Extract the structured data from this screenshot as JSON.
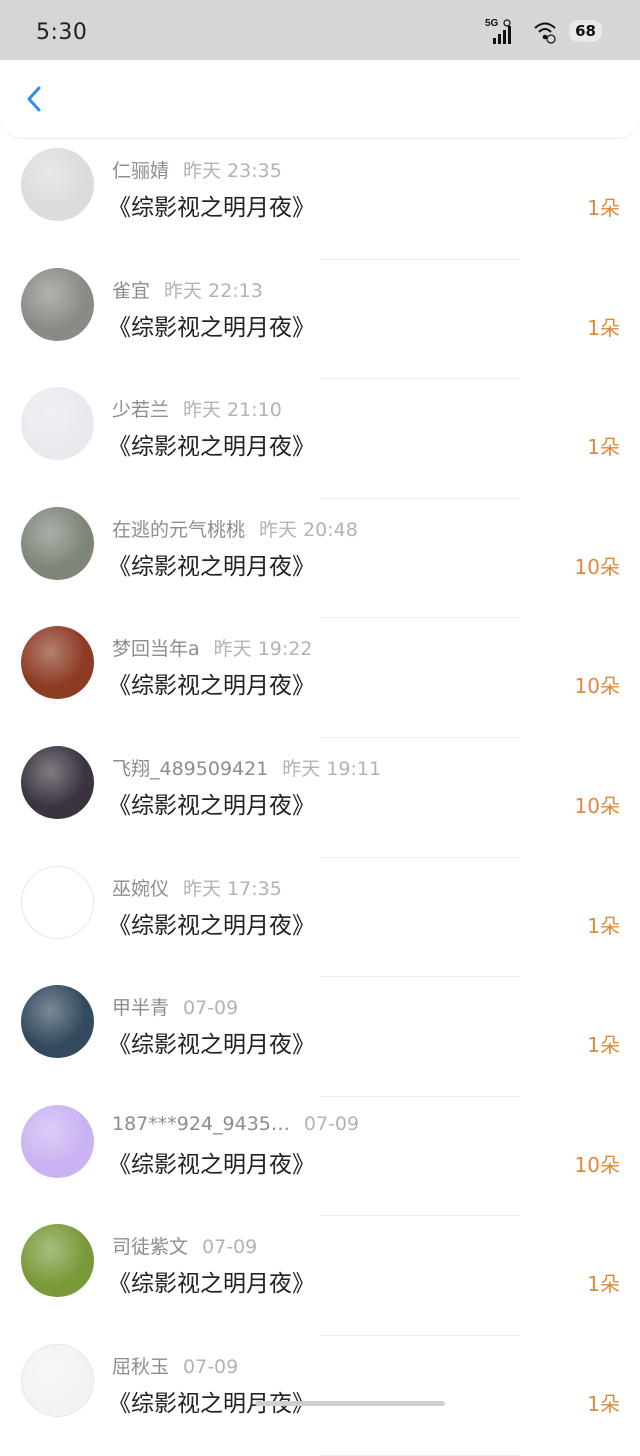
{
  "status_bar": {
    "time": "5:30",
    "network": "5G",
    "battery": "68"
  },
  "header": {
    "back_icon": "chevron-left-icon"
  },
  "items": [
    {
      "name": "仁骊婧",
      "time": "昨天 23:35",
      "title": "《综影视之明月夜》",
      "gift": "1朵",
      "avatar_color": "#dcdcdc"
    },
    {
      "name": "雀宜",
      "time": "昨天 22:13",
      "title": "《综影视之明月夜》",
      "gift": "1朵",
      "avatar_color": "#8a8a86"
    },
    {
      "name": "少若兰",
      "time": "昨天 21:10",
      "title": "《综影视之明月夜》",
      "gift": "1朵",
      "avatar_color": "#e9e9ef"
    },
    {
      "name": "在逃的元气桃桃",
      "time": "昨天 20:48",
      "title": "《综影视之明月夜》",
      "gift": "10朵",
      "avatar_color": "#7e8679"
    },
    {
      "name": "梦回当年a",
      "time": "昨天 19:22",
      "title": "《综影视之明月夜》",
      "gift": "10朵",
      "avatar_color": "#8d3b23"
    },
    {
      "name": "飞翔_489509421",
      "time": "昨天 19:11",
      "title": "《综影视之明月夜》",
      "gift": "10朵",
      "avatar_color": "#3b3440"
    },
    {
      "name": "巫婉仪",
      "time": "昨天 17:35",
      "title": "《综影视之明月夜》",
      "gift": "1朵",
      "avatar_color": "#ffffff"
    },
    {
      "name": "甲半青",
      "time": "07-09",
      "title": "《综影视之明月夜》",
      "gift": "1朵",
      "avatar_color": "#334a5e"
    },
    {
      "name": "187***924_9435…",
      "time": "07-09",
      "title": "《综影视之明月夜》",
      "gift": "10朵",
      "avatar_color": "#c9b3f3"
    },
    {
      "name": "司徒紫文",
      "time": "07-09",
      "title": "《综影视之明月夜》",
      "gift": "1朵",
      "avatar_color": "#7a9a3a"
    },
    {
      "name": "屈秋玉",
      "time": "07-09",
      "title": "《综影视之明月夜》",
      "gift": "1朵",
      "avatar_color": "#f3f3f3"
    }
  ],
  "colors": {
    "accent_blue": "#2f8ff0",
    "gift_orange": "#e0893a"
  }
}
